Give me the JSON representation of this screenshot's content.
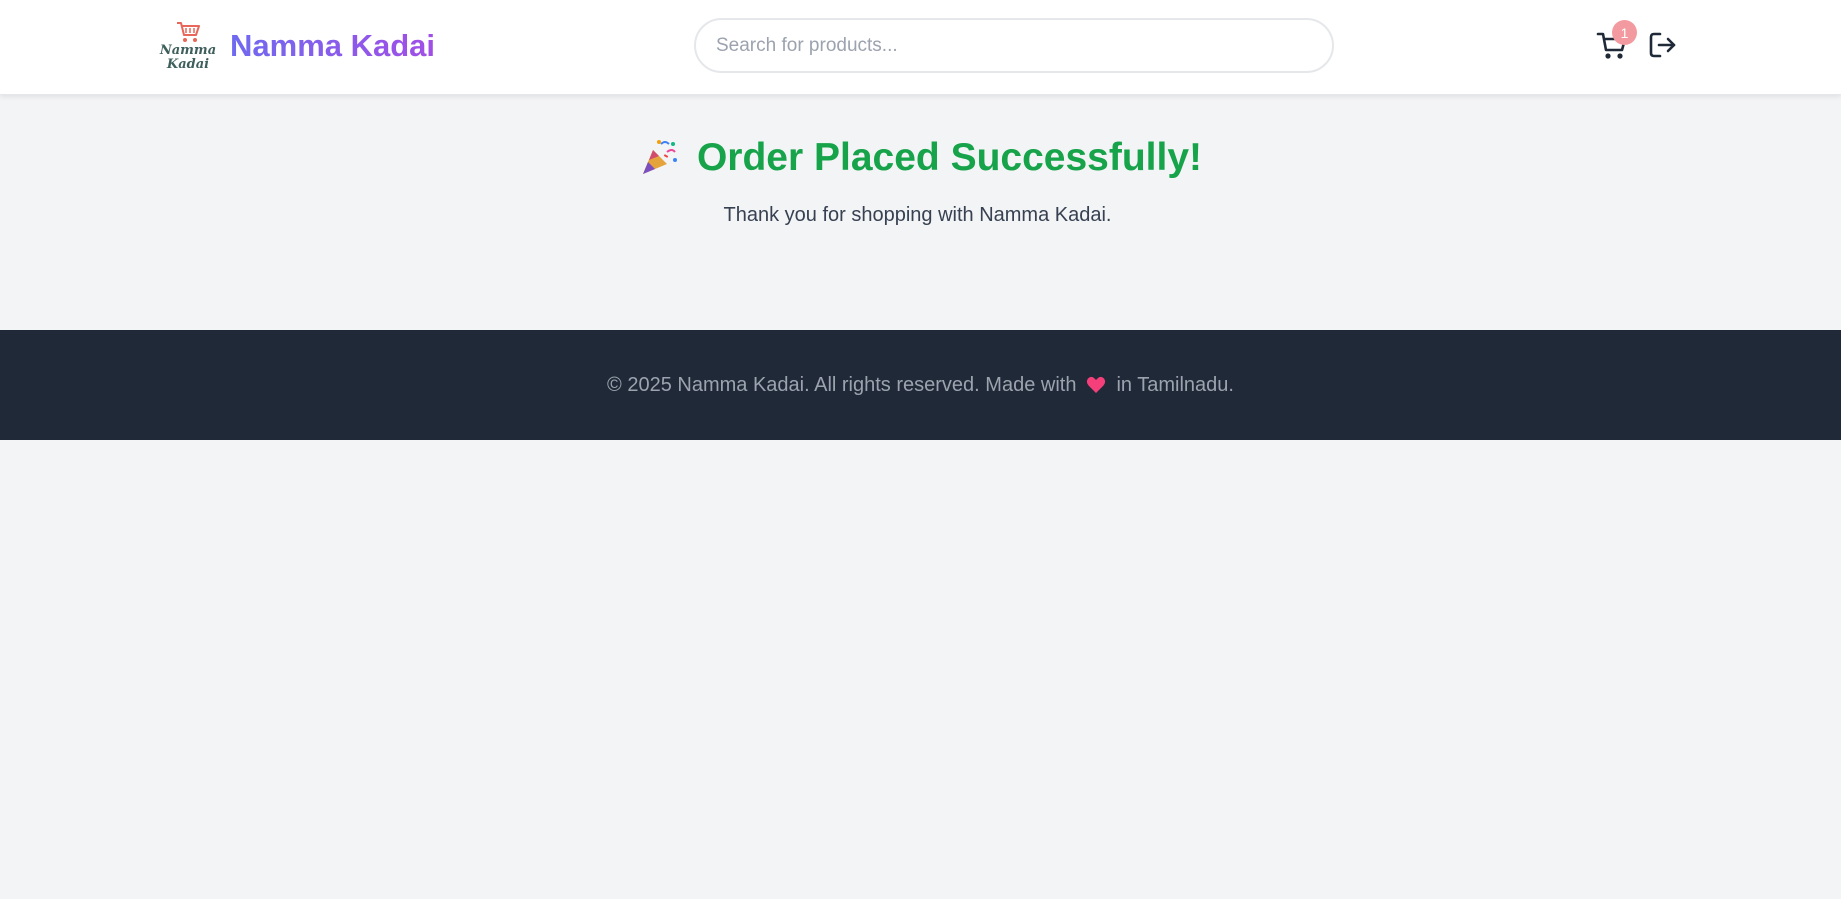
{
  "header": {
    "brand_name": "Namma Kadai",
    "logo": {
      "line1": "Namma",
      "line2": "Kadai"
    },
    "search": {
      "placeholder": "Search for products...",
      "value": ""
    },
    "cart": {
      "icon": "cart-icon",
      "count": "1"
    },
    "logout": {
      "icon": "logout-icon"
    }
  },
  "main": {
    "icon": "party-popper-icon",
    "title": "Order Placed Successfully!",
    "subtitle": "Thank you for shopping with Namma Kadai."
  },
  "footer": {
    "text_before": "© 2025 Namma Kadai. All rights reserved. Made with",
    "icon": "heart-icon",
    "text_after": "in Tamilnadu."
  },
  "colors": {
    "brand_start": "#6f6af0",
    "brand_end": "#a24ee6",
    "success": "#16a34a",
    "footer_bg": "#1f2937",
    "badge": "#f39aa0"
  }
}
